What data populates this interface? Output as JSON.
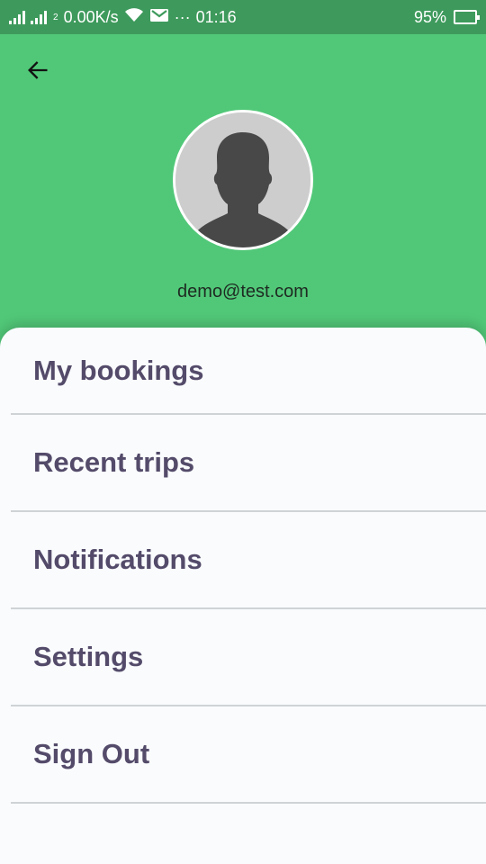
{
  "status_bar": {
    "sim_label": "2",
    "network_speed": "0.00K/s",
    "more": "···",
    "time": "01:16",
    "battery": "95%"
  },
  "profile": {
    "email": "demo@test.com"
  },
  "menu": {
    "items": [
      {
        "label": "My bookings"
      },
      {
        "label": "Recent trips"
      },
      {
        "label": "Notifications"
      },
      {
        "label": "Settings"
      },
      {
        "label": "Sign Out"
      }
    ]
  },
  "icons": {
    "back": "arrow-back-icon",
    "avatar": "person-silhouette-icon",
    "wifi": "wifi-icon",
    "mail": "mail-icon",
    "signal": "signal-icon",
    "battery": "battery-icon"
  },
  "colors": {
    "header_green": "#51c878",
    "status_bar_green": "#3e9a5c",
    "sheet_bg": "#f9fbfd",
    "menu_text": "#544b6a",
    "divider": "#cfd3d6"
  }
}
